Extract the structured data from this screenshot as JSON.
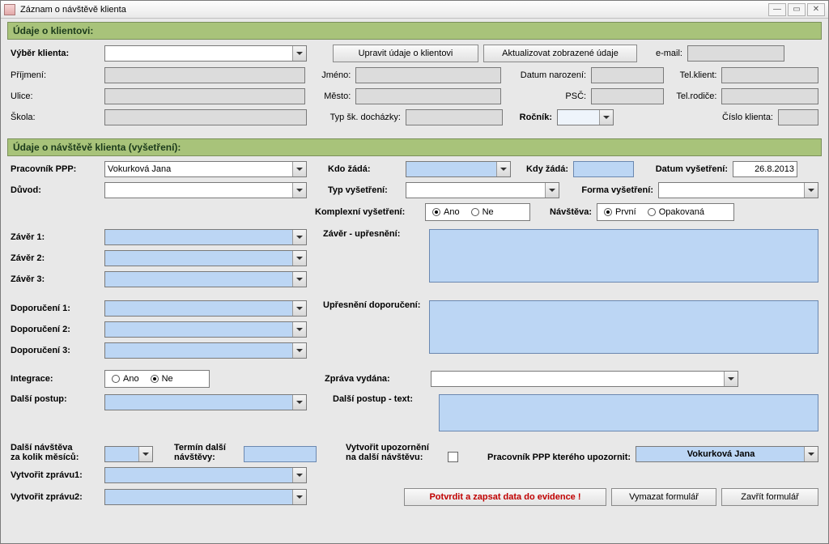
{
  "window": {
    "title": "Záznam o návštěvě klienta"
  },
  "section1": {
    "title": "Údaje o klientovi:"
  },
  "client": {
    "vyber_label": "Výběr klienta:",
    "upravit_btn": "Upravit údaje o klientovi",
    "aktual_btn": "Aktualizovat zobrazené údaje",
    "email_label": "e-mail:",
    "prijmeni_label": "Příjmení:",
    "jmeno_label": "Jméno:",
    "datum_nar_label": "Datum narození:",
    "tel_klient_label": "Tel.klient:",
    "ulice_label": "Ulice:",
    "mesto_label": "Město:",
    "psc_label": "PSČ:",
    "tel_rodice_label": "Tel.rodiče:",
    "skola_label": "Škola:",
    "typ_sk_label": "Typ šk. docházky:",
    "rocnik_label": "Ročník:",
    "cislo_klienta_label": "Číslo klienta:"
  },
  "section2": {
    "title": "Údaje o návštěvě klienta (vyšetření):"
  },
  "visit": {
    "pracovnik_label": "Pracovník PPP:",
    "pracovnik_val": "Vokurková Jana",
    "kdo_zada_label": "Kdo žádá:",
    "kdy_zada_label": "Kdy žádá:",
    "datum_vys_label": "Datum vyšetření:",
    "datum_vys_val": "26.8.2013",
    "duvod_label": "Důvod:",
    "typ_vys_label": "Typ vyšetření:",
    "forma_vys_label": "Forma vyšetření:",
    "komplex_label": "Komplexní vyšetření:",
    "ano": "Ano",
    "ne": "Ne",
    "navsteva_label": "Návštěva:",
    "prvni": "První",
    "opakovana": "Opakovaná",
    "zaver1": "Závěr 1:",
    "zaver2": "Závěr 2:",
    "zaver3": "Závěr 3:",
    "zaver_up": "Závěr - upřesnění:",
    "dop1": "Doporučení 1:",
    "dop2": "Doporučení 2:",
    "dop3": "Doporučení 3:",
    "up_dop": "Upřesnění doporučení:",
    "integrace": "Integrace:",
    "zprava_vydana": "Zpráva vydána:",
    "dalsi_postup": "Další postup:",
    "dalsi_postup_text": "Další postup - text:",
    "dalsi_navsteva_l1": "Další návštěva",
    "dalsi_navsteva_l2": "za kolik měsíců:",
    "termin_l1": "Termín další",
    "termin_l2": "návštěvy:",
    "upozorneni_l1": "Vytvořit upozornění",
    "upozorneni_l2": "na další návštěvu:",
    "ppp_upozornit": "Pracovník PPP kterého upozornit:",
    "ppp_upozornit_val": "Vokurková Jana",
    "vytvorit_zpravu1": "Vytvořit zprávu1:",
    "vytvorit_zpravu2": "Vytvořit zprávu2:",
    "potvrdit_btn": "Potvrdit a zapsat data do evidence !",
    "vymazat_btn": "Vymazat formulář",
    "zavrit_btn": "Zavřít formulář"
  }
}
